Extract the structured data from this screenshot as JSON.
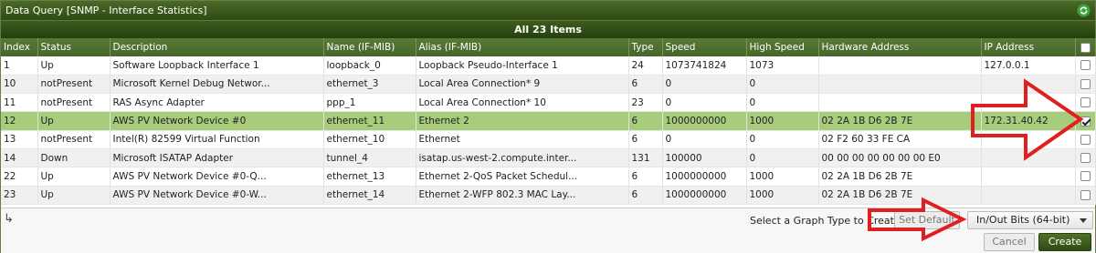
{
  "window": {
    "title": "Data Query [SNMP - Interface Statistics]"
  },
  "summary": {
    "text": "All 23 Items"
  },
  "columns": [
    "Index",
    "Status",
    "Description",
    "Name (IF-MIB)",
    "Alias (IF-MIB)",
    "Type",
    "Speed",
    "High Speed",
    "Hardware Address",
    "IP Address"
  ],
  "rows": [
    {
      "index": "1",
      "status": "Up",
      "description": "Software Loopback Interface 1",
      "name": "loopback_0",
      "alias": "Loopback Pseudo-Interface 1",
      "type": "24",
      "speed": "1073741824",
      "high_speed": "1073",
      "hw": "",
      "ip": "127.0.0.1",
      "checked": false
    },
    {
      "index": "10",
      "status": "notPresent",
      "description": "Microsoft Kernel Debug Networ...",
      "name": "ethernet_3",
      "alias": "Local Area Connection* 9",
      "type": "6",
      "speed": "0",
      "high_speed": "0",
      "hw": "",
      "ip": "",
      "checked": false
    },
    {
      "index": "11",
      "status": "notPresent",
      "description": "RAS Async Adapter",
      "name": "ppp_1",
      "alias": "Local Area Connection* 10",
      "type": "23",
      "speed": "0",
      "high_speed": "0",
      "hw": "",
      "ip": "",
      "checked": false
    },
    {
      "index": "12",
      "status": "Up",
      "description": "AWS PV Network Device #0",
      "name": "ethernet_11",
      "alias": "Ethernet 2",
      "type": "6",
      "speed": "1000000000",
      "high_speed": "1000",
      "hw": "02 2A 1B D6 2B 7E",
      "ip": "172.31.40.42",
      "checked": true
    },
    {
      "index": "13",
      "status": "notPresent",
      "description": "Intel(R) 82599 Virtual Function",
      "name": "ethernet_10",
      "alias": "Ethernet",
      "type": "6",
      "speed": "0",
      "high_speed": "0",
      "hw": "02 F2 60 33 FE CA",
      "ip": "",
      "checked": false
    },
    {
      "index": "14",
      "status": "Down",
      "description": "Microsoft ISATAP Adapter",
      "name": "tunnel_4",
      "alias": "isatap.us-west-2.compute.inter...",
      "type": "131",
      "speed": "100000",
      "high_speed": "0",
      "hw": "00 00 00 00 00 00 00 E0",
      "ip": "",
      "checked": false
    },
    {
      "index": "22",
      "status": "Up",
      "description": "AWS PV Network Device #0-Q...",
      "name": "ethernet_13",
      "alias": "Ethernet 2-QoS Packet Schedul...",
      "type": "6",
      "speed": "1000000000",
      "high_speed": "1000",
      "hw": "02 2A 1B D6 2B 7E",
      "ip": "",
      "checked": false
    },
    {
      "index": "23",
      "status": "Up",
      "description": "AWS PV Network Device #0-W...",
      "name": "ethernet_14",
      "alias": "Ethernet 2-WFP 802.3 MAC Lay...",
      "type": "6",
      "speed": "1000000000",
      "high_speed": "1000",
      "hw": "02 2A 1B D6 2B 7E",
      "ip": "",
      "checked": false
    }
  ],
  "footer": {
    "graph_label": "Select a Graph Type to Create",
    "set_default": "Set Default",
    "graph_type": "In/Out Bits (64-bit)",
    "cancel": "Cancel",
    "create": "Create"
  },
  "colors": {
    "header_green": "#46662a",
    "selected_row": "#a7cc7c",
    "arrow_red": "#e02020"
  }
}
